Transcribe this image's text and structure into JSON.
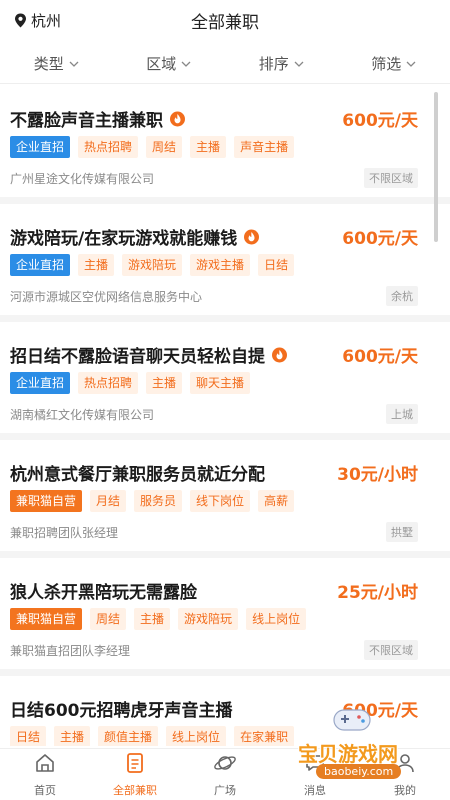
{
  "header": {
    "location": "杭州",
    "title": "全部兼职"
  },
  "filters": [
    {
      "label": "类型"
    },
    {
      "label": "区域"
    },
    {
      "label": "排序"
    },
    {
      "label": "筛选"
    }
  ],
  "jobs": [
    {
      "title": "不露脸声音主播兼职",
      "hot": true,
      "salary": "600元/天",
      "badge": "企业直招",
      "badge_color": "#2b8de6",
      "tags": [
        "热点招聘",
        "周结",
        "主播",
        "声音主播"
      ],
      "company": "广州星途文化传媒有限公司",
      "area": "不限区域"
    },
    {
      "title": "游戏陪玩/在家玩游戏就能赚钱",
      "hot": true,
      "salary": "600元/天",
      "badge": "企业直招",
      "badge_color": "#2b8de6",
      "tags": [
        "主播",
        "游戏陪玩",
        "游戏主播",
        "日结"
      ],
      "company": "河源市源城区空优网络信息服务中心",
      "area": "余杭"
    },
    {
      "title": "招日结不露脸语音聊天员轻松自提",
      "hot": true,
      "salary": "600元/天",
      "badge": "企业直招",
      "badge_color": "#2b8de6",
      "tags": [
        "热点招聘",
        "主播",
        "聊天主播"
      ],
      "company": "湖南橘红文化传媒有限公司",
      "area": "上城"
    },
    {
      "title": "杭州意式餐厅兼职服务员就近分配",
      "hot": false,
      "salary": "30元/小时",
      "badge": "兼职猫自营",
      "badge_color": "#f3741f",
      "tags": [
        "月结",
        "服务员",
        "线下岗位",
        "高薪"
      ],
      "company": "兼职招聘团队张经理",
      "area": "拱墅"
    },
    {
      "title": "狼人杀开黑陪玩无需露脸",
      "hot": false,
      "salary": "25元/小时",
      "badge": "兼职猫自营",
      "badge_color": "#f3741f",
      "tags": [
        "周结",
        "主播",
        "游戏陪玩",
        "线上岗位"
      ],
      "company": "兼职猫直招团队李经理",
      "area": "不限区域"
    },
    {
      "title": "日结600元招聘虎牙声音主播",
      "hot": false,
      "salary": "600元/天",
      "badge": "日结",
      "badge_color": "#fff1e6",
      "tags": [
        "主播",
        "颜值主播",
        "线上岗位",
        "在家兼职"
      ],
      "company": "",
      "area": ""
    }
  ],
  "tabbar": [
    {
      "label": "首页",
      "icon": "home-icon",
      "active": false
    },
    {
      "label": "全部兼职",
      "icon": "document-icon",
      "active": true
    },
    {
      "label": "广场",
      "icon": "planet-icon",
      "active": false
    },
    {
      "label": "消息",
      "icon": "message-icon",
      "active": false
    },
    {
      "label": "我的",
      "icon": "profile-icon",
      "active": false
    }
  ],
  "watermark": {
    "text": "宝贝游戏网",
    "url": "baobeiy.com"
  },
  "colors": {
    "accent": "#f26d1d",
    "blue_badge": "#2b8de6",
    "orange_badge": "#f3741f"
  }
}
